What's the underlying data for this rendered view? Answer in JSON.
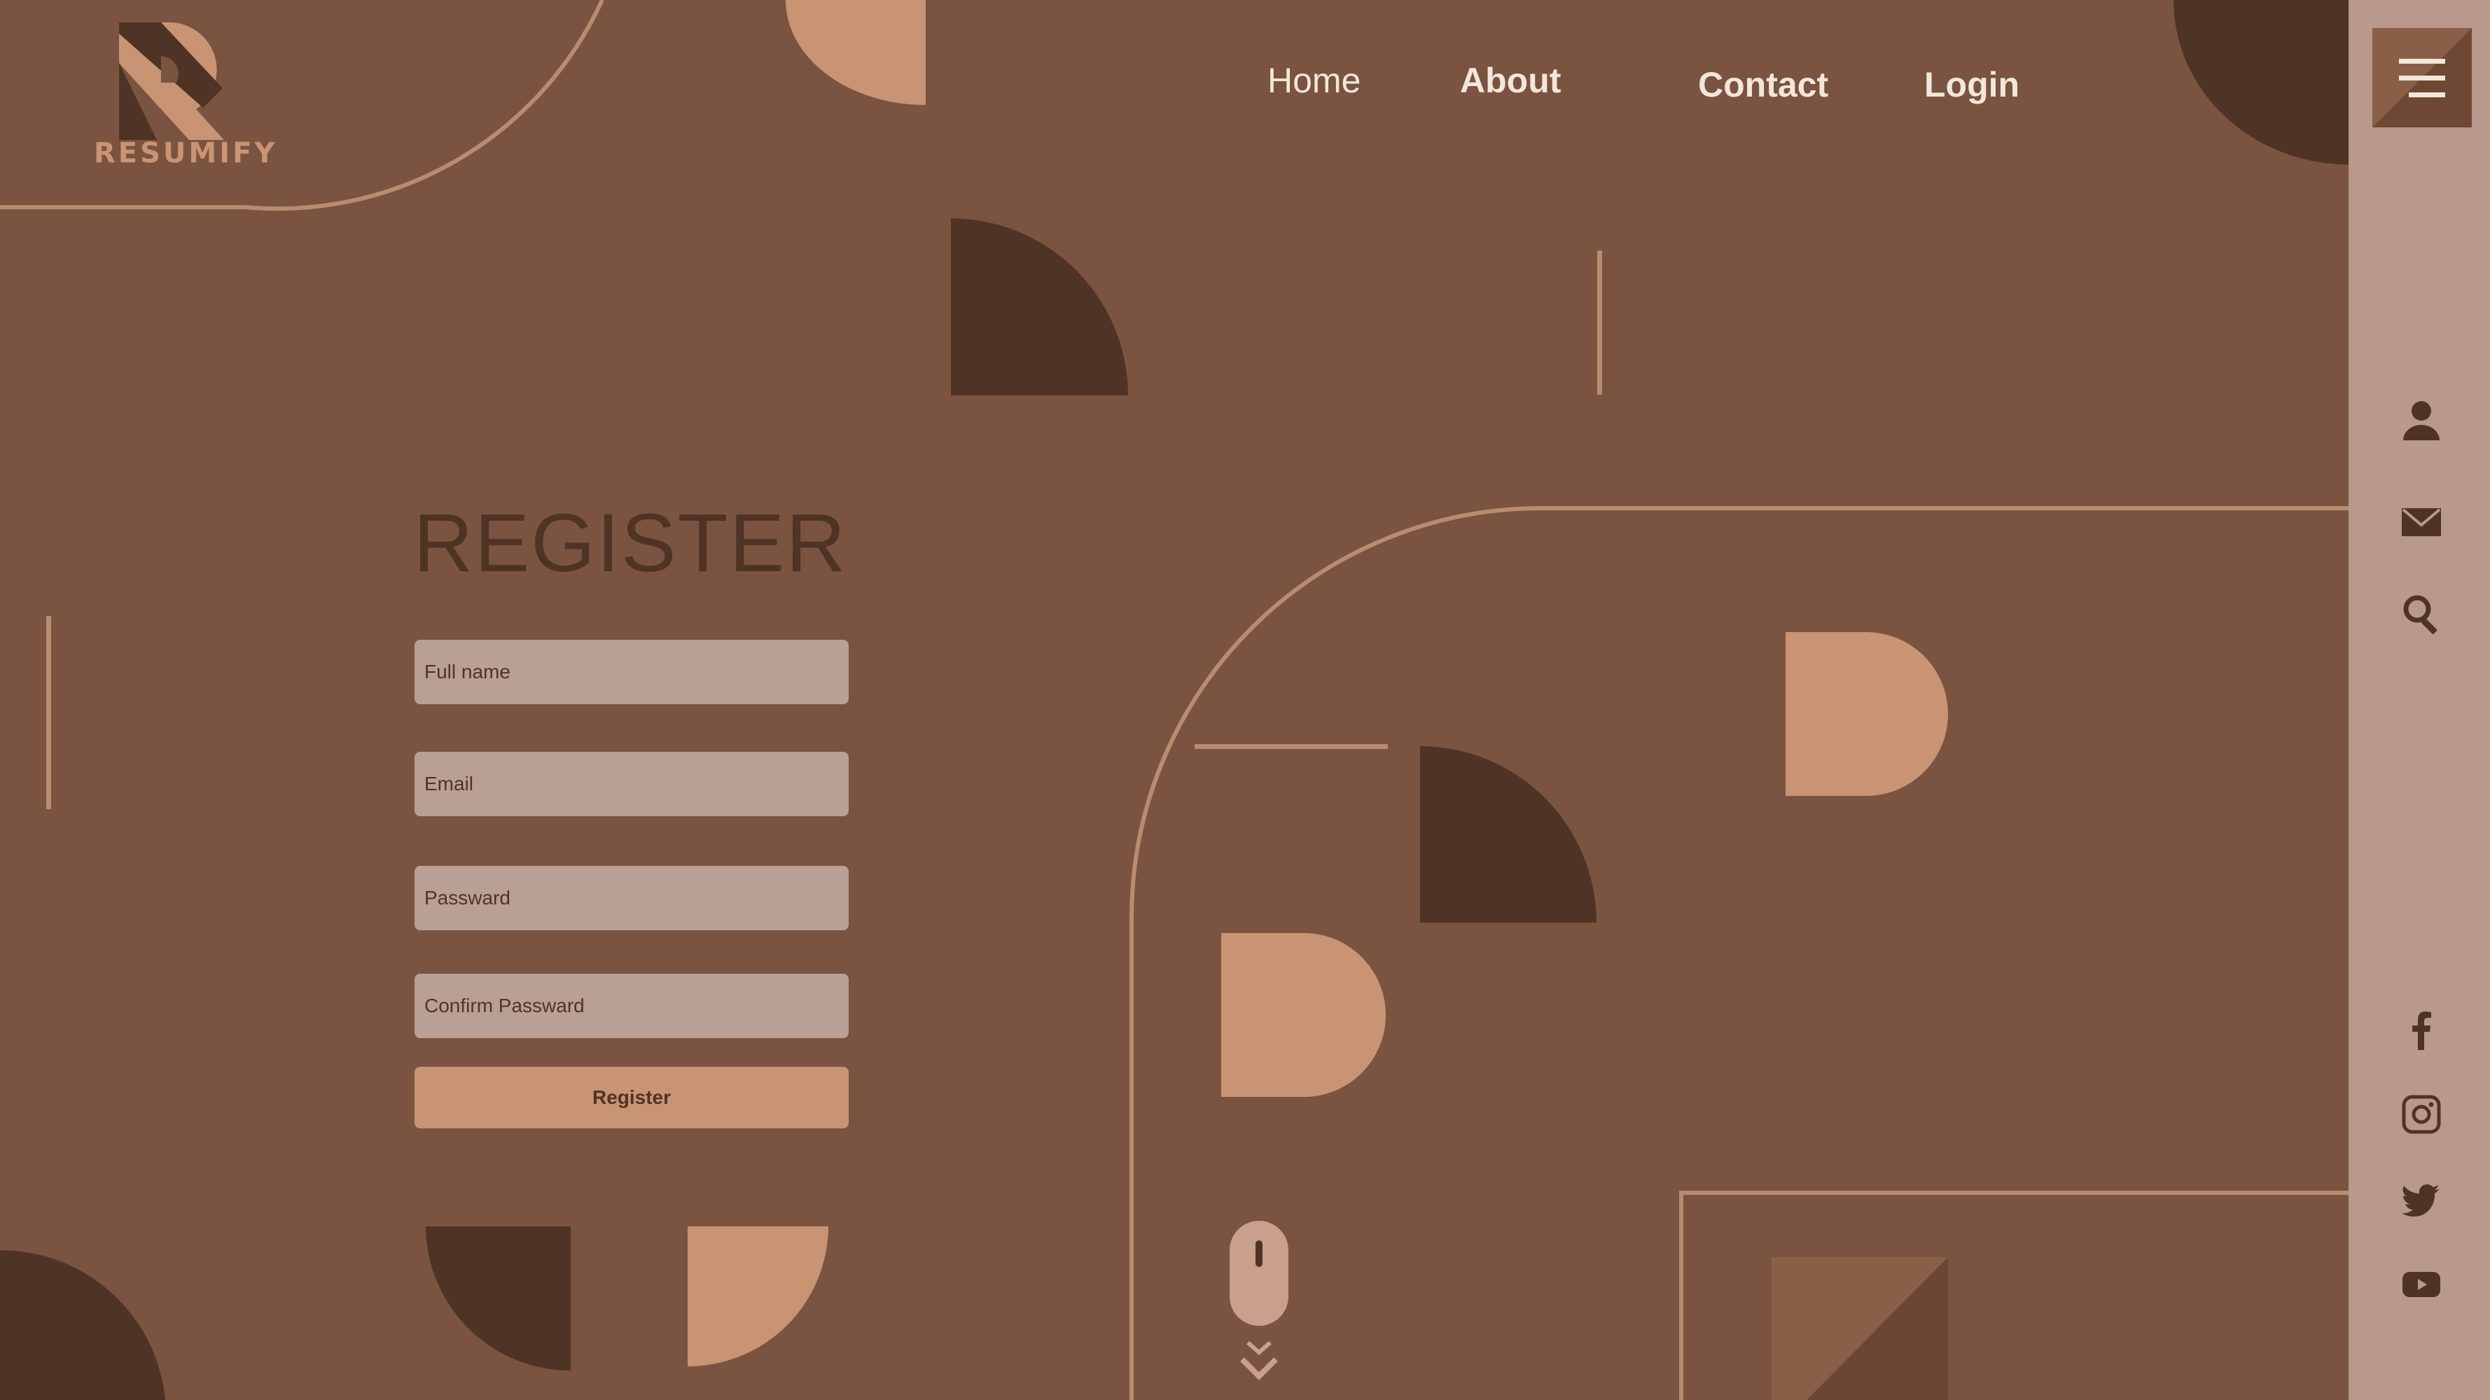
{
  "brand": {
    "name": "RESUMIFY"
  },
  "nav": {
    "home": "Home",
    "about": "About",
    "contact": "Contact",
    "login": "Login"
  },
  "register": {
    "title": "REGISTER",
    "full_name_placeholder": "Full name",
    "email_placeholder": "Email",
    "password_placeholder": "Passward",
    "confirm_placeholder": "Confirm Passward",
    "button_label": "Register"
  },
  "sidebar": {
    "icons": [
      "menu-icon",
      "user-icon",
      "mail-icon",
      "search-icon",
      "facebook-icon",
      "instagram-icon",
      "twitter-icon",
      "youtube-icon"
    ]
  },
  "colors": {
    "background": "#7A5440",
    "dark_shape": "#4F3426",
    "light_shape": "#C99474",
    "sidebar": "#B8998B",
    "field": "#B8A096",
    "nav_text": "#F3E6DA"
  }
}
